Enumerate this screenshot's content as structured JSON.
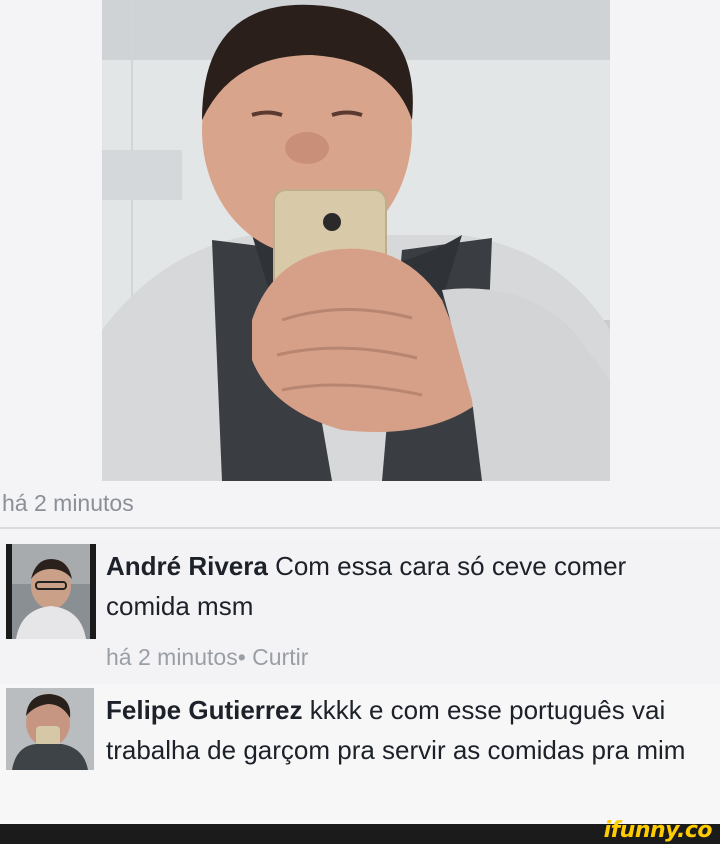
{
  "post": {
    "time": "há 2 minutos"
  },
  "comments": [
    {
      "author": "André Rivera",
      "text": " Com essa cara só ceve comer comida msm",
      "time": "há 2 minutos",
      "separator": "•",
      "like_label": "Curtir"
    },
    {
      "author": "Felipe Gutierrez",
      "text": " kkkk e com esse português vai trabalha de garçom pra servir as comidas pra mim"
    }
  ],
  "watermark": {
    "text": "ifunny.co"
  },
  "colors": {
    "background": "#f4f4f6",
    "text": "#1d2129",
    "meta": "#9a9ea5",
    "watermark": "#ffcc00"
  }
}
